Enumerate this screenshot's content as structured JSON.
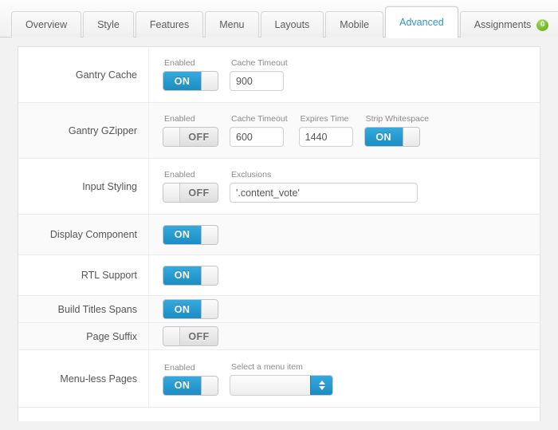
{
  "tabs": [
    {
      "label": "Overview",
      "active": false,
      "badge": null
    },
    {
      "label": "Style",
      "active": false,
      "badge": null
    },
    {
      "label": "Features",
      "active": false,
      "badge": null
    },
    {
      "label": "Menu",
      "active": false,
      "badge": null
    },
    {
      "label": "Layouts",
      "active": false,
      "badge": null
    },
    {
      "label": "Mobile",
      "active": false,
      "badge": null
    },
    {
      "label": "Advanced",
      "active": true,
      "badge": null
    },
    {
      "label": "Assignments",
      "active": false,
      "badge": "0"
    }
  ],
  "rows": {
    "gantry_cache": {
      "label": "Gantry Cache",
      "enabled_label": "Enabled",
      "enabled_state": "ON",
      "cache_timeout_label": "Cache Timeout",
      "cache_timeout_value": "900"
    },
    "gantry_gzipper": {
      "label": "Gantry GZipper",
      "enabled_label": "Enabled",
      "enabled_state": "OFF",
      "cache_timeout_label": "Cache Timeout",
      "cache_timeout_value": "600",
      "expires_time_label": "Expires Time",
      "expires_time_value": "1440",
      "strip_whitespace_label": "Strip Whitespace",
      "strip_whitespace_state": "ON"
    },
    "input_styling": {
      "label": "Input Styling",
      "enabled_label": "Enabled",
      "enabled_state": "OFF",
      "exclusions_label": "Exclusions",
      "exclusions_value": "'.content_vote'"
    },
    "display_component": {
      "label": "Display Component",
      "state": "ON"
    },
    "rtl_support": {
      "label": "RTL Support",
      "state": "ON"
    },
    "build_titles_spans": {
      "label": "Build Titles Spans",
      "state": "ON"
    },
    "page_suffix": {
      "label": "Page Suffix",
      "state": "OFF"
    },
    "menu_less_pages": {
      "label": "Menu-less Pages",
      "enabled_label": "Enabled",
      "enabled_state": "ON",
      "select_label": "Select a menu item",
      "select_value": ""
    }
  },
  "colors": {
    "accent_blue": "#1b8dc4",
    "badge_green": "#76bd29",
    "active_tab_text": "#2e93c9"
  }
}
